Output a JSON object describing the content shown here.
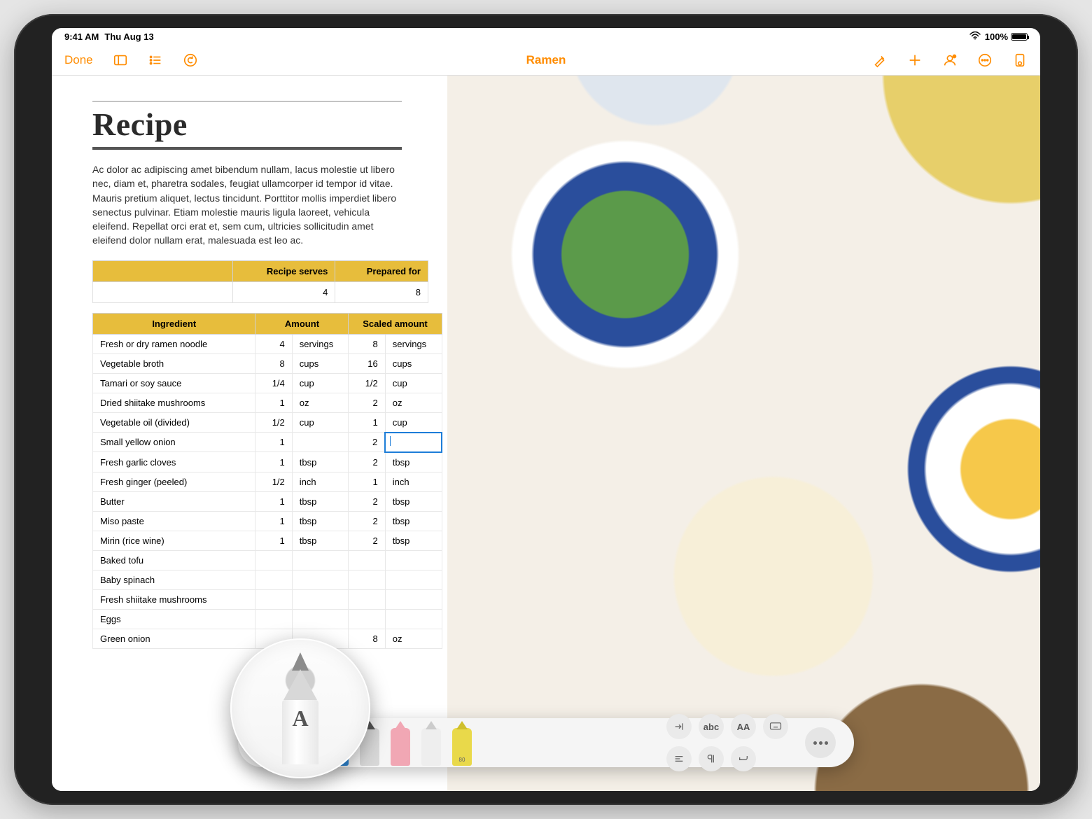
{
  "status": {
    "time": "9:41 AM",
    "date": "Thu Aug 13",
    "battery_pct": "100%"
  },
  "toolbar": {
    "done": "Done",
    "title": "Ramen"
  },
  "doc": {
    "heading": "Recipe",
    "body": "Ac dolor ac adipiscing amet bibendum nullam, lacus molestie ut libero nec, diam et, pharetra sodales, feugiat ullamcorper id tempor id vitae. Mauris pretium aliquet, lectus tincidunt. Porttitor mollis imperdiet libero senectus pulvinar. Etiam molestie mauris ligula laoreet, vehicula eleifend. Repellat orci erat et, sem cum, ultricies sollicitudin amet eleifend dolor nullam erat, malesuada est leo ac."
  },
  "serves": {
    "headers": [
      "Recipe serves",
      "Prepared for"
    ],
    "values": [
      "4",
      "8"
    ]
  },
  "ingredients": {
    "headers": [
      "Ingredient",
      "Amount",
      "Scaled amount"
    ],
    "rows": [
      {
        "name": "Fresh or dry ramen noodle",
        "amt": "4",
        "unit": "servings",
        "samt": "8",
        "sunit": "servings"
      },
      {
        "name": "Vegetable broth",
        "amt": "8",
        "unit": "cups",
        "samt": "16",
        "sunit": "cups"
      },
      {
        "name": "Tamari or soy sauce",
        "amt": "1/4",
        "unit": "cup",
        "samt": "1/2",
        "sunit": "cup"
      },
      {
        "name": "Dried shiitake mushrooms",
        "amt": "1",
        "unit": "oz",
        "samt": "2",
        "sunit": "oz"
      },
      {
        "name": "Vegetable oil (divided)",
        "amt": "1/2",
        "unit": "cup",
        "samt": "1",
        "sunit": "cup"
      },
      {
        "name": "Small yellow onion",
        "amt": "1",
        "unit": "",
        "samt": "2",
        "sunit": "",
        "active": true
      },
      {
        "name": "Fresh garlic cloves",
        "amt": "1",
        "unit": "tbsp",
        "samt": "2",
        "sunit": "tbsp"
      },
      {
        "name": "Fresh ginger (peeled)",
        "amt": "1/2",
        "unit": "inch",
        "samt": "1",
        "sunit": "inch"
      },
      {
        "name": "Butter",
        "amt": "1",
        "unit": "tbsp",
        "samt": "2",
        "sunit": "tbsp"
      },
      {
        "name": "Miso paste",
        "amt": "1",
        "unit": "tbsp",
        "samt": "2",
        "sunit": "tbsp"
      },
      {
        "name": "Mirin (rice wine)",
        "amt": "1",
        "unit": "tbsp",
        "samt": "2",
        "sunit": "tbsp"
      },
      {
        "name": "Baked tofu",
        "amt": "",
        "unit": "",
        "samt": "",
        "sunit": ""
      },
      {
        "name": "Baby spinach",
        "amt": "",
        "unit": "",
        "samt": "",
        "sunit": ""
      },
      {
        "name": "Fresh shiitake mushrooms",
        "amt": "",
        "unit": "",
        "samt": "",
        "sunit": ""
      },
      {
        "name": "Eggs",
        "amt": "",
        "unit": "",
        "samt": "",
        "sunit": ""
      },
      {
        "name": "Green onion",
        "amt": "",
        "unit": "",
        "samt": "8",
        "sunit": "oz"
      }
    ]
  },
  "magnifier": {
    "letter": "A"
  },
  "scribble": {
    "tools": [
      "pen",
      "crayon",
      "pencil",
      "eraser",
      "plain",
      "highlighter"
    ],
    "right_icons": [
      "indent",
      "abc",
      "text-size",
      "keyboard",
      "align",
      "paragraph",
      "return",
      "blank"
    ],
    "right_labels": {
      "abc": "abc",
      "textsize": "AA"
    },
    "hl_value": "80"
  }
}
